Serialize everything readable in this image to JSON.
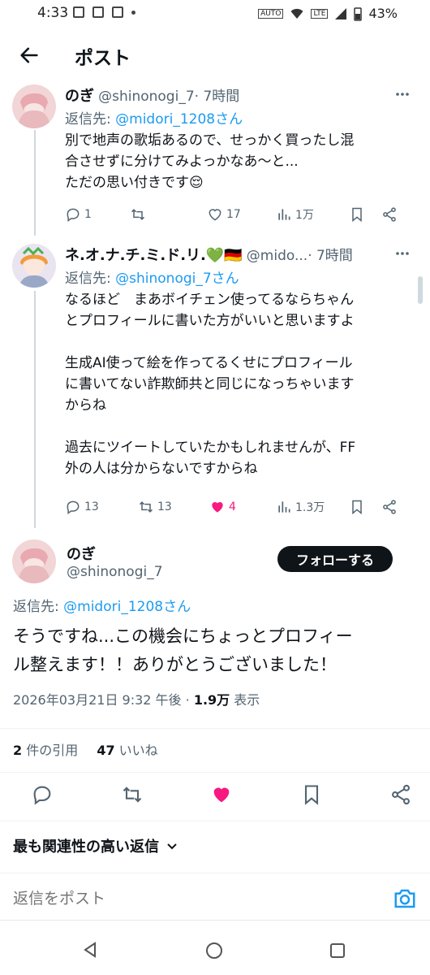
{
  "status_bar": {
    "time": "4:33",
    "battery": "43%",
    "indicators": [
      "auto-icon",
      "wifi-icon",
      "volte-icon",
      "signal-icon",
      "battery-icon"
    ]
  },
  "header": {
    "title": "ポスト"
  },
  "tweets": [
    {
      "name": "のぎ",
      "handle": "@shinonogi_7",
      "time": "· 7時間",
      "reply_label": "返信先: ",
      "reply_to": "@midori_1208さん",
      "text": "別で地声の歌垢あるので、せっかく買ったし混\n合させずに分けてみよっかなあ～と...\nただの思い付きです😌",
      "replies": "1",
      "retweets": "",
      "likes": "17",
      "views": "1万",
      "liked": false
    },
    {
      "name": "ネ.オ.ナ.チ.ミ.ド.リ.💚🇩🇪",
      "handle": "@mido...",
      "time": "· 7時間",
      "reply_label": "返信先: ",
      "reply_to": "@shinonogi_7さん",
      "text": "なるほど　まあボイチェン使ってるならちゃん\nとプロフィールに書いた方がいいと思いますよ\n\n生成AI使って絵を作ってるくせにプロフィール\nに書いてない詐欺師共と同じになっちゃいます\nからね\n\n過去にツイートしていたかもしれませんが、FF\n外の人は分からないですからね",
      "replies": "13",
      "retweets": "13",
      "likes": "4",
      "views": "1.3万",
      "liked": true
    }
  ],
  "main_post": {
    "name": "のぎ",
    "handle": "@shinonogi_7",
    "follow_label": "フォローする",
    "reply_label": "返信先: ",
    "reply_to": "@midori_1208さん",
    "text": "そうですね...この機会にちょっとプロフィー\nル整えます！！ありがとうございました！",
    "timestamp": "2026年03月21日 9:32 午後 · ",
    "views_count": "1.9万",
    "views_label": " 表示",
    "quotes_count": "2",
    "quotes_label": " 件の引用",
    "likes_count": "47",
    "likes_label": " いいね"
  },
  "sort_label": "最も関連性の高い返信",
  "reply_box": {
    "placeholder": "返信をポスト"
  },
  "colors": {
    "accent": "#1d9bf0",
    "like": "#f91880",
    "text": "#0f1419",
    "muted": "#536471"
  }
}
